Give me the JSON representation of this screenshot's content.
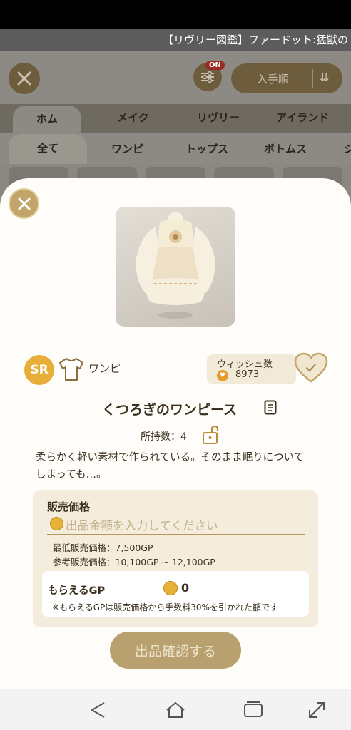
{
  "ticker": "【リヴリー図鑑】ファードット:猛獣の",
  "background": {
    "sort_label": "入手順",
    "filter_badge": "ON",
    "top_tabs": [
      "ホム",
      "メイク",
      "リヴリー",
      "アイランド"
    ],
    "sub_tabs": [
      "全て",
      "ワンピ",
      "トップス",
      "ボトムス",
      "シ"
    ]
  },
  "item": {
    "rarity": "SR",
    "category": "ワンピ",
    "name": "くつろぎのワンピース",
    "owned": "所持数：4",
    "description": "柔らかく軽い素材で作られている。そのまま眠りについてしまっても…。"
  },
  "wish": {
    "label": "ウィッシュ数",
    "count": "8973"
  },
  "price": {
    "title": "販売価格",
    "placeholder": "出品金額を入力してください",
    "min": "最低販売価格：7,500GP",
    "reference": "参考販売価格：10,100GP ~ 12,100GP"
  },
  "gp": {
    "label": "もらえるGP",
    "value": "0",
    "note": "※もらえるGPは販売価格から手数料30%を引かれた額です"
  },
  "confirm_label": "出品確認する",
  "colors": {
    "accent": "#c1a56a",
    "rarity": "#e8ae3a",
    "button": "#b8a06f"
  }
}
